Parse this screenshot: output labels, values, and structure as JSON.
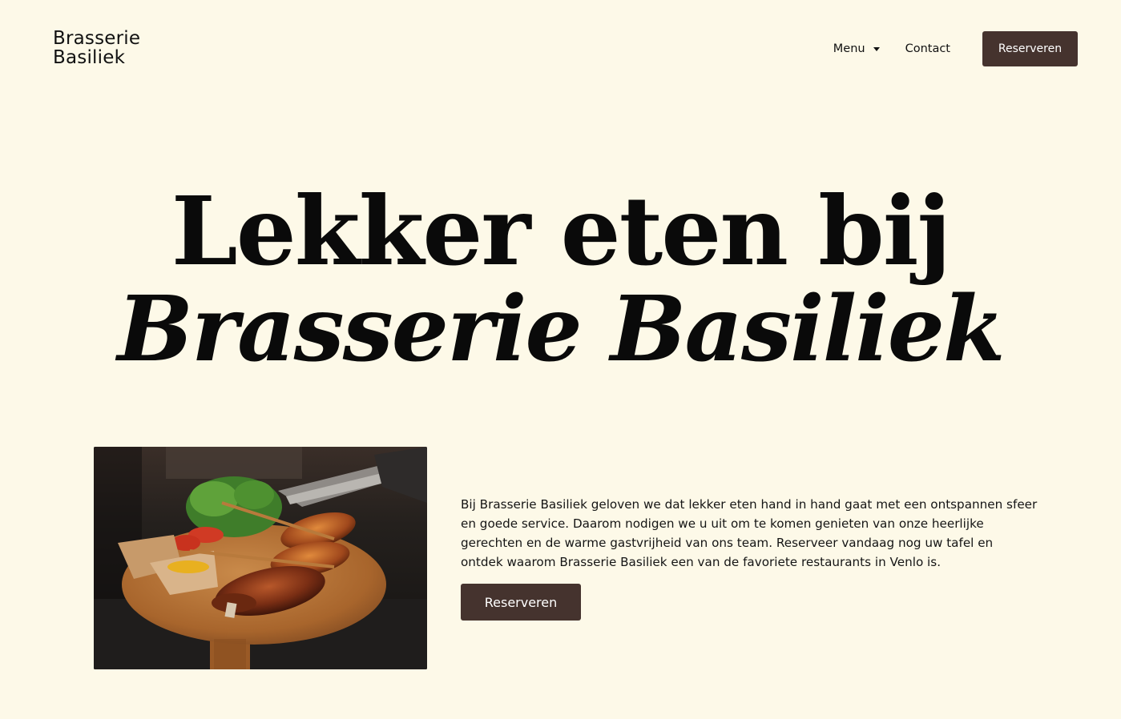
{
  "header": {
    "logo_line1": "Brasserie",
    "logo_line2": "Basiliek",
    "nav": {
      "menu_label": "Menu",
      "contact_label": "Contact",
      "reserve_label": "Reserveren"
    }
  },
  "hero": {
    "title_line1": "Lekker eten bij",
    "title_line2": "Brasserie Basiliek"
  },
  "intro": {
    "text": "Bij Brasserie Basiliek geloven we dat lekker eten hand in hand gaat met een ontspannen sfeer en goede service. Daarom nodigen we u uit om te komen genieten van onze heerlijke gerechten en de warme gastvrijheid van ons team. Reserveer vandaag nog uw tafel en ontdek waarom Brasserie Basiliek een van de favoriete restaurants in Venlo is.",
    "button_label": "Reserveren"
  },
  "colors": {
    "background": "#fdf9e8",
    "button": "#45332e",
    "text": "#111111"
  },
  "icons": {
    "menu_caret": "chevron-down-icon"
  }
}
